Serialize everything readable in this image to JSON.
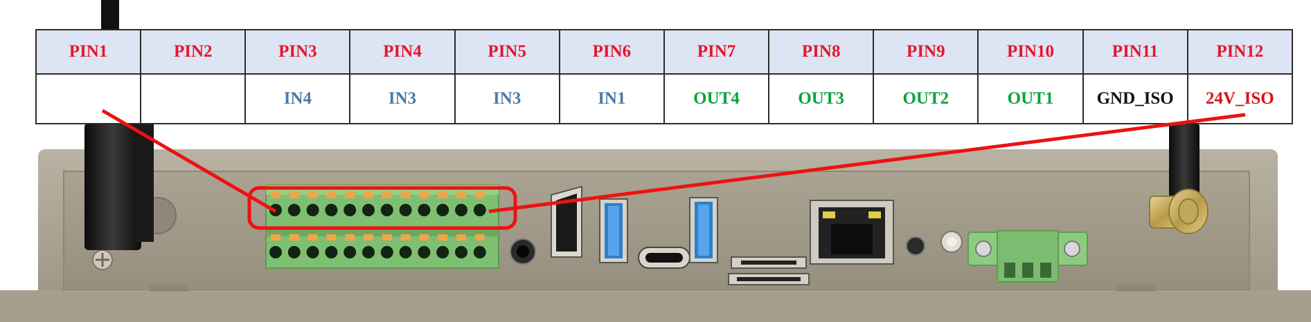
{
  "colors": {
    "pin_header_text": "#e8152a",
    "header_bg": "#dde4f3",
    "input": "#4a79a8",
    "output": "#0aa23c",
    "ground": "#111111",
    "power": "#d61219",
    "callout": "#ee1111",
    "terminal_green": "#86c77a",
    "terminal_orange": "#f0a44c",
    "usb_blue": "#3d8bd8",
    "chassis": "#a29b8a"
  },
  "pins": [
    {
      "name": "PIN1",
      "function": "",
      "kind": "none"
    },
    {
      "name": "PIN2",
      "function": "",
      "kind": "none"
    },
    {
      "name": "PIN3",
      "function": "IN4",
      "kind": "input"
    },
    {
      "name": "PIN4",
      "function": "IN3",
      "kind": "input"
    },
    {
      "name": "PIN5",
      "function": "IN3",
      "kind": "input"
    },
    {
      "name": "PIN6",
      "function": "IN1",
      "kind": "input"
    },
    {
      "name": "PIN7",
      "function": "OUT4",
      "kind": "output"
    },
    {
      "name": "PIN8",
      "function": "OUT3",
      "kind": "output"
    },
    {
      "name": "PIN9",
      "function": "OUT2",
      "kind": "output"
    },
    {
      "name": "PIN10",
      "function": "OUT1",
      "kind": "output"
    },
    {
      "name": "PIN11",
      "function": "GND_ISO",
      "kind": "ground"
    },
    {
      "name": "PIN12",
      "function": "24V_ISO",
      "kind": "power"
    }
  ],
  "device": {
    "terminal_block": {
      "rows": 2,
      "pins_per_row": 12
    },
    "ports": [
      "antenna-left",
      "terminal-block",
      "audio-jack",
      "hdmi-port",
      "usb-a-port-1",
      "usb-c-port",
      "usb-a-port-2",
      "sim-slot",
      "sd-slot",
      "ethernet-port",
      "led-indicator",
      "power-button",
      "power-terminal",
      "antenna-right"
    ]
  }
}
